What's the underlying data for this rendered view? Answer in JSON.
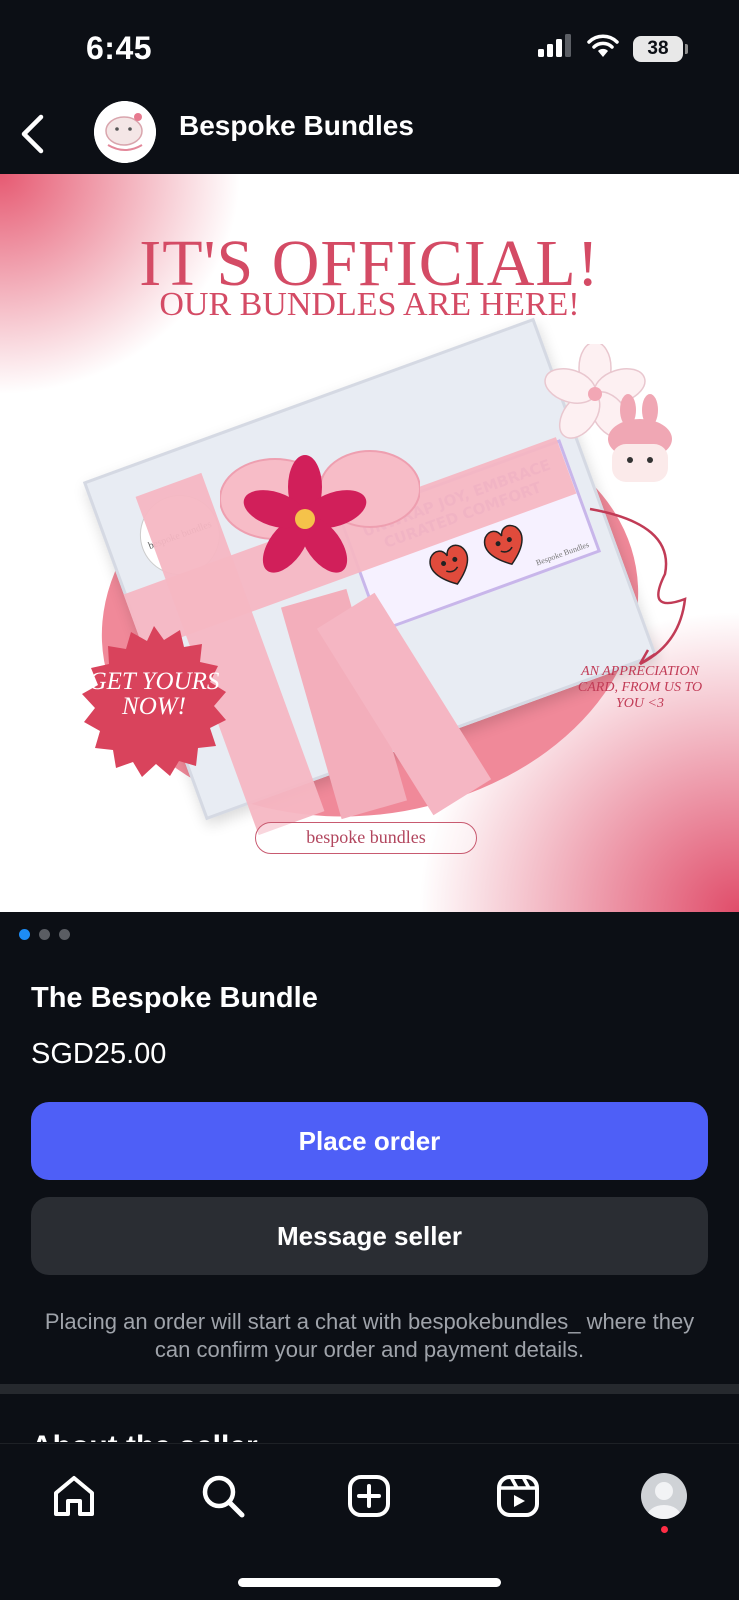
{
  "status_bar": {
    "time": "6:45",
    "battery": "38"
  },
  "header": {
    "seller_name": "Bespoke Bundles"
  },
  "hero": {
    "title": "IT'S OFFICIAL!",
    "subtitle": "OUR BUNDLES ARE HERE!",
    "sticker_text": "bespoke bundles",
    "card_text": "UNWRAP JOY, EMBRACE CURATED COMFORT",
    "card_footer": "Bespoke Bundles",
    "badge_text": "GET YOURS NOW!",
    "note_text": "AN APPRECIATION CARD, FROM US TO YOU <3",
    "brand_label": "bespoke bundles"
  },
  "pager": {
    "total": 3,
    "active": 1
  },
  "product": {
    "title": "The Bespoke Bundle",
    "price": "SGD25.00"
  },
  "actions": {
    "place_order": "Place order",
    "message_seller": "Message seller"
  },
  "order_note": "Placing an order will start a chat with bespokebundles_ where they can confirm your order and payment details.",
  "about": {
    "heading": "About the seller"
  },
  "bottom_nav": {
    "items": [
      {
        "icon": "home-icon"
      },
      {
        "icon": "search-icon"
      },
      {
        "icon": "create-icon"
      },
      {
        "icon": "reels-icon"
      },
      {
        "icon": "profile-avatar"
      }
    ]
  },
  "colors": {
    "background": "#0c0f15",
    "primary_button": "#4e5ff7",
    "secondary_button": "#2a2d33",
    "active_dot": "#1d8cf5",
    "hero_accent": "#d44b65",
    "notification": "#ff2d45"
  }
}
